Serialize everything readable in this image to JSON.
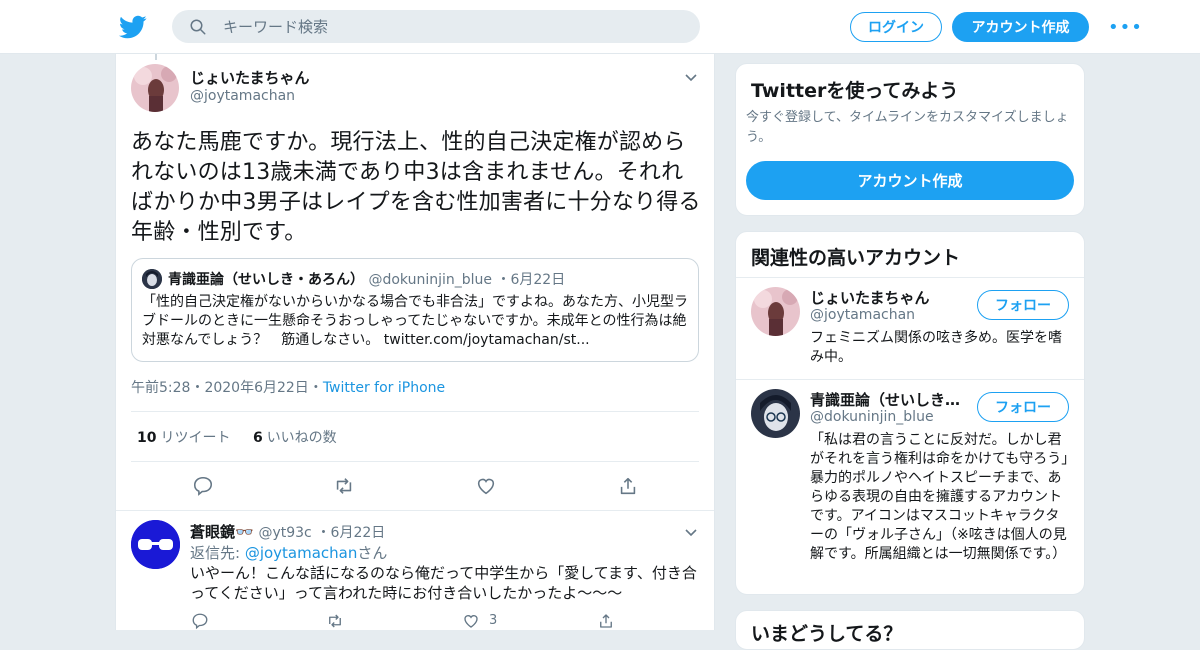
{
  "header": {
    "search_placeholder": "キーワード検索",
    "login_label": "ログイン",
    "signup_label": "アカウント作成",
    "more_label": "•••"
  },
  "tweet": {
    "name": "じょいたまちゃん",
    "handle": "@joytamachan",
    "text": "あなた馬鹿ですか。現行法上、性的自己決定権が認められないのは13歳未満であり中3は含まれません。それればかりか中3男子はレイプを含む性加害者に十分なり得る年齢・性別です。",
    "quote": {
      "name": "青識亜論（せいしき・あろん）",
      "handle": "@dokuninjin_blue",
      "date": "6月22日",
      "text": "「性的自己決定権がないからいかなる場合でも非合法」ですよね。あなた方、小児型ラブドールのときに一生懸命そうおっしゃってたじゃないですか。未成年との性行為は絶対悪なんでしょう？　筋通しなさい。 twitter.com/joytamachan/st..."
    },
    "time": "午前5:28",
    "date": "2020年6月22日",
    "source": "Twitter for iPhone",
    "retweet_count": "10",
    "retweet_label": "リツイート",
    "like_count": "6",
    "like_label": "いいねの数"
  },
  "reply": {
    "name": "蒼眼鏡👓",
    "handle": "@yt93c",
    "date": "6月22日",
    "reply_to_prefix": "返信先: ",
    "reply_to_mention": "@joytamachan",
    "reply_to_suffix": "さん",
    "text": "いやーん！こんな話になるのなら俺だって中学生から「愛してます、付き合ってください」って言われた時にお付き合いしたかったよ〜〜〜",
    "like_count": "3"
  },
  "sidebar": {
    "try_card": {
      "title": "Twitterを使ってみよう",
      "desc": "今すぐ登録して、タイムラインをカスタマイズしましょう。",
      "cta": "アカウント作成"
    },
    "related": {
      "title": "関連性の高いアカウント",
      "follow_label": "フォロー",
      "accounts": [
        {
          "name": "じょいたまちゃん",
          "handle": "@joytamachan",
          "bio": "フェミニズム関係の呟き多め。医学を嗜み中。"
        },
        {
          "name": "青識亜論（せいしき…",
          "handle": "@dokuninjin_blue",
          "bio": "「私は君の言うことに反対だ。しかし君がそれを言う権利は命をかけても守ろう」暴力的ポルノやヘイトスピーチまで、あらゆる表現の自由を擁護するアカウントです。アイコンはマスコットキャラクターの「ヴォル子さん」（※呟きは個人の見解です。所属組織とは一切無関係です。）"
        }
      ]
    },
    "trends_title": "いまどうしてる？"
  },
  "colors": {
    "accent": "#1da1f2",
    "link": "#1b95e0",
    "muted": "#657786",
    "background": "#e6ecf0"
  }
}
